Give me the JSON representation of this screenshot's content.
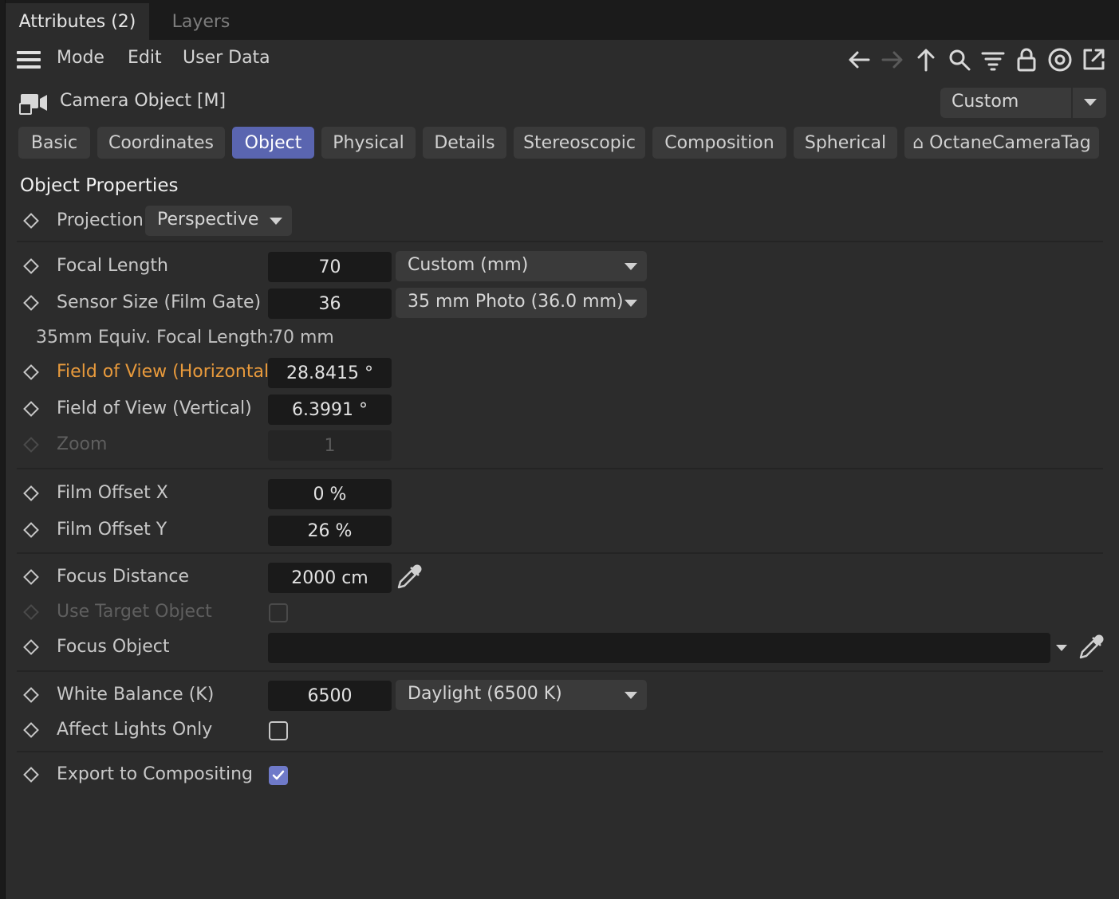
{
  "tabs": [
    {
      "label": "Attributes (2)",
      "active": true
    },
    {
      "label": "Layers",
      "active": false
    }
  ],
  "menu": {
    "items": [
      "Mode",
      "Edit",
      "User Data"
    ],
    "toolbar_icons": [
      "back-arrow-icon",
      "forward-arrow-icon",
      "up-arrow-icon",
      "search-icon",
      "filter-icon",
      "lock-icon",
      "target-icon",
      "new-window-icon"
    ]
  },
  "object": {
    "title": "Camera Object [M]",
    "preset": "Custom"
  },
  "categories": [
    {
      "label": "Basic",
      "selected": false
    },
    {
      "label": "Coordinates",
      "selected": false
    },
    {
      "label": "Object",
      "selected": true
    },
    {
      "label": "Physical",
      "selected": false
    },
    {
      "label": "Details",
      "selected": false
    },
    {
      "label": "Stereoscopic",
      "selected": false
    },
    {
      "label": "Composition",
      "selected": false
    },
    {
      "label": "Spherical",
      "selected": false
    },
    {
      "label": "⌂ OctaneCameraTag",
      "selected": false
    }
  ],
  "section_title": "Object Properties",
  "params": {
    "projection": {
      "label": "Projection",
      "value": "Perspective"
    },
    "focal_length": {
      "label": "Focal Length",
      "value": "70",
      "preset": "Custom (mm)"
    },
    "sensor_size": {
      "label": "Sensor Size (Film Gate)",
      "value": "36",
      "preset": "35 mm Photo (36.0 mm)"
    },
    "equiv": {
      "label": "35mm Equiv. Focal Length:",
      "value": "70 mm"
    },
    "fov_h": {
      "label": "Field of View (Horizontal)",
      "value": "28.8415 °"
    },
    "fov_v": {
      "label": "Field of View (Vertical)",
      "value": "6.3991 °"
    },
    "zoom": {
      "label": "Zoom",
      "value": "1"
    },
    "film_offset_x": {
      "label": "Film Offset X",
      "value": "0 %"
    },
    "film_offset_y": {
      "label": "Film Offset Y",
      "value": "26 %"
    },
    "focus_distance": {
      "label": "Focus Distance",
      "value": "2000 cm"
    },
    "use_target": {
      "label": "Use Target Object",
      "checked": false
    },
    "focus_object": {
      "label": "Focus Object",
      "value": ""
    },
    "white_balance": {
      "label": "White Balance (K)",
      "value": "6500",
      "preset": "Daylight (6500 K)"
    },
    "affect_lights": {
      "label": "Affect Lights Only",
      "checked": false
    },
    "export_comp": {
      "label": "Export to Compositing",
      "checked": true
    }
  },
  "colors": {
    "panel_bg": "#2c2c2c",
    "field_bg": "#1a1a1a",
    "button_bg": "#3a3a3a",
    "selected_tab": "#5a65b0",
    "highlight_label": "#e89a3c",
    "checkbox_on": "#6f7ac9"
  }
}
